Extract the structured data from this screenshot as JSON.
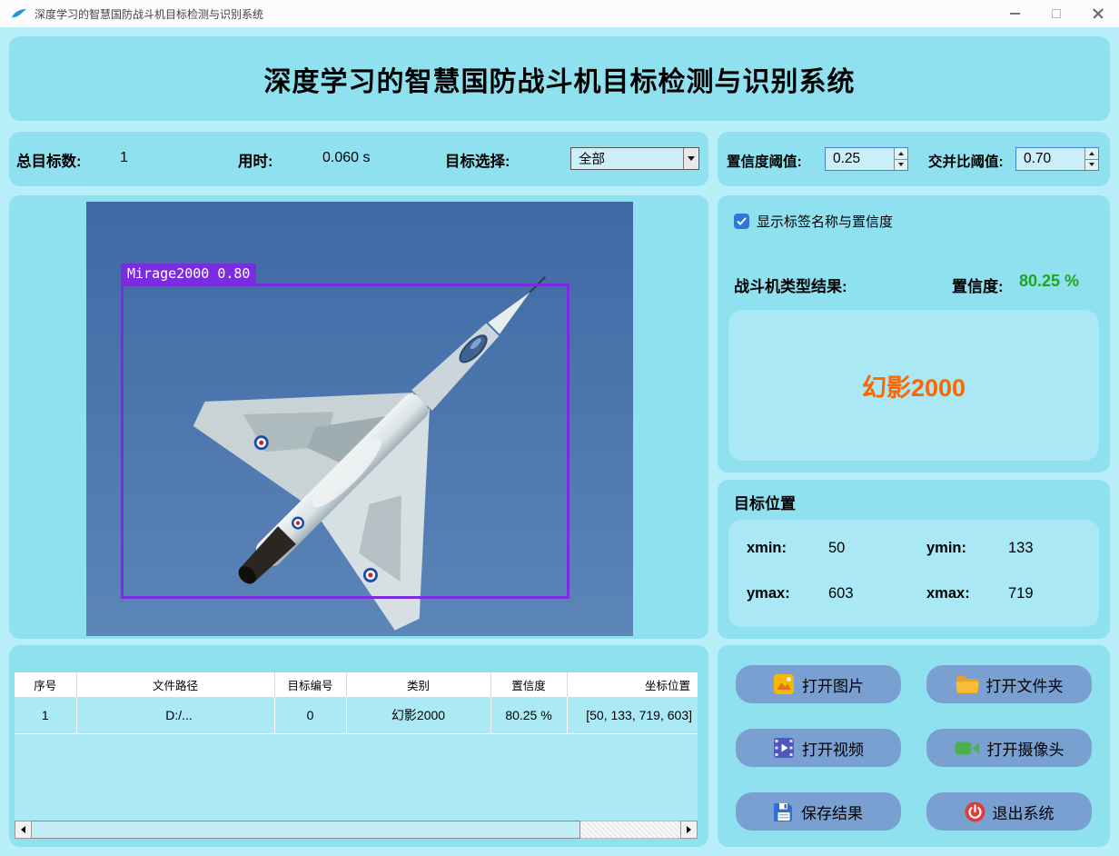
{
  "window": {
    "title": "深度学习的智慧国防战斗机目标检测与识别系统"
  },
  "banner": {
    "title": "深度学习的智慧国防战斗机目标检测与识别系统"
  },
  "stats": {
    "total_label": "总目标数:",
    "total_value": "1",
    "time_label": "用时:",
    "time_value": "0.060 s",
    "target_select_label": "目标选择:",
    "target_select_value": "全部"
  },
  "thresholds": {
    "conf_label": "置信度阈值:",
    "conf_value": "0.25",
    "iou_label": "交并比阈值:",
    "iou_value": "0.70"
  },
  "detection": {
    "show_labels_checkbox": "显示标签名称与置信度",
    "checkbox_checked": true,
    "type_result_label": "战斗机类型结果:",
    "confidence_label": "置信度:",
    "confidence_value": "80.25 %",
    "result_text": "幻影2000",
    "bbox_label": "Mirage2000 0.80"
  },
  "position": {
    "title": "目标位置",
    "fields": [
      {
        "label": "xmin:",
        "value": "50"
      },
      {
        "label": "ymin:",
        "value": "133"
      },
      {
        "label": "ymax:",
        "value": "603"
      },
      {
        "label": "xmax:",
        "value": "719"
      }
    ]
  },
  "table": {
    "headers": [
      "序号",
      "文件路径",
      "目标编号",
      "类别",
      "置信度",
      "坐标位置"
    ],
    "rows": [
      [
        "1",
        "D:/...",
        "0",
        "幻影2000",
        "80.25 %",
        "[50, 133, 719, 603]"
      ]
    ]
  },
  "buttons": {
    "open_image": "打开图片",
    "open_folder": "打开文件夹",
    "open_video": "打开视频",
    "open_camera": "打开摄像头",
    "save_results": "保存结果",
    "exit_system": "退出系统"
  },
  "colors": {
    "background": "#b7eef8",
    "panel": "#8fe1f0",
    "inner_box": "#a9e8f4",
    "button_blue": "#7aa0d2",
    "result_orange": "#ff6600",
    "confidence_green": "#1fa621",
    "bbox_purple": "#7c2ce0",
    "checkbox_blue": "#2e78d6"
  }
}
